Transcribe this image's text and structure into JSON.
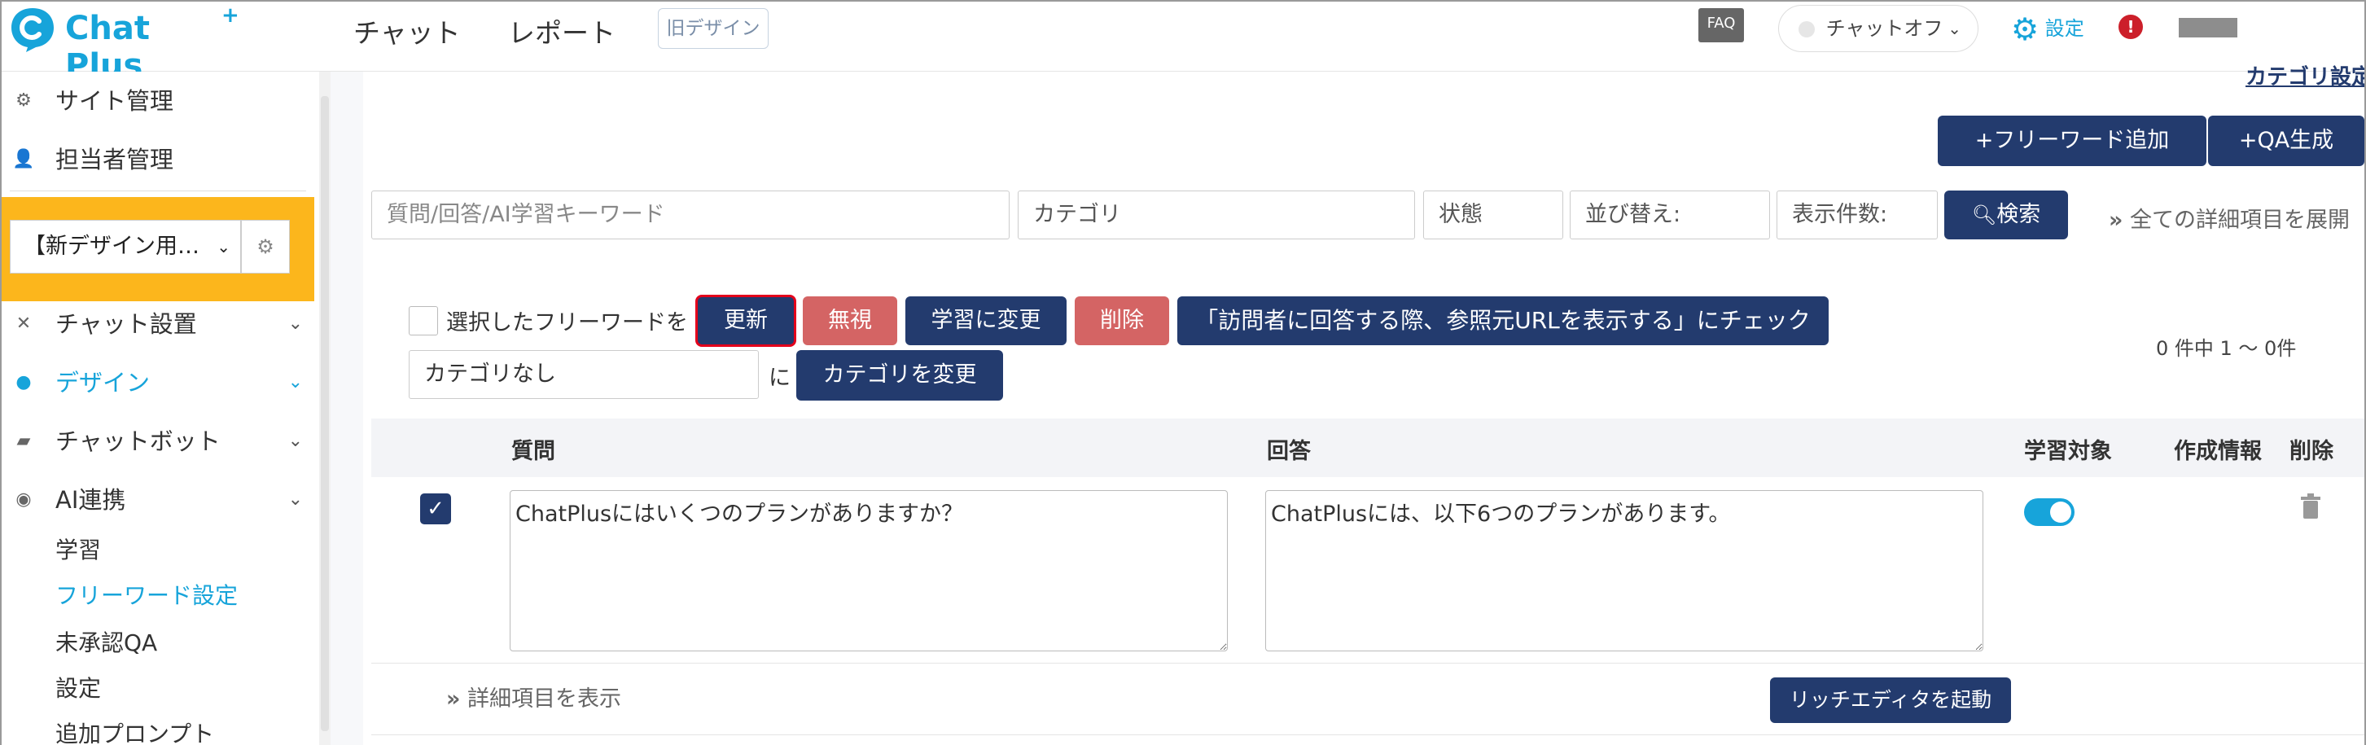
{
  "header": {
    "logo_text": "Chat Plus",
    "logo_plus": "+",
    "nav": [
      "チャット",
      "レポート"
    ],
    "old_design_label": "旧デザイン",
    "faq_label": "FAQ",
    "chat_status_label": "チャットオフ",
    "settings_label": "設定",
    "alert_icon": "!",
    "top_right_link": "カテゴリ設定"
  },
  "sidebar": {
    "site_admin": "サイト管理",
    "staff_admin": "担当者管理",
    "site_select_value": "【新デザイン用…",
    "chat_setup": "チャット設置",
    "design": "デザイン",
    "chatbot": "チャットボット",
    "ai_link": "AI連携",
    "sub_items": [
      "学習",
      "フリーワード設定",
      "未承認QA",
      "設定",
      "追加プロンプト"
    ],
    "active_color": "#17a4da"
  },
  "toolbar": {
    "add_freeword": "フリーワード追加",
    "qa_generate": "QA生成",
    "keyword_placeholder": "質問/回答/AI学習キーワード",
    "category_placeholder": "カテゴリ",
    "status_placeholder": "状態",
    "sort_label": "並び替え:",
    "per_page_label": "表示件数:",
    "search_button": "検索",
    "expand_all": "全ての詳細項目を展開"
  },
  "bulk": {
    "selected_label": "選択したフリーワードを",
    "update": "更新",
    "ignore": "無視",
    "to_learning": "学習に変更",
    "delete": "削除",
    "url_check": "「訪問者に回答する際、参照元URLを表示する」にチェック",
    "category_value": "カテゴリなし",
    "ni": "に",
    "change_category": "カテゴリを変更",
    "count": "0 件中 1 ～ 0件"
  },
  "table": {
    "headers": [
      "質問",
      "回答",
      "学習対象",
      "作成情報",
      "削除"
    ],
    "rows": [
      {
        "question": "ChatPlusにはいくつのプランがありますか？",
        "answer": "ChatPlusには、以下6つのプランがあります。",
        "learning": true
      }
    ],
    "detail_toggle": "詳細項目を表示",
    "rich_editor": "リッチエディタを起動"
  }
}
